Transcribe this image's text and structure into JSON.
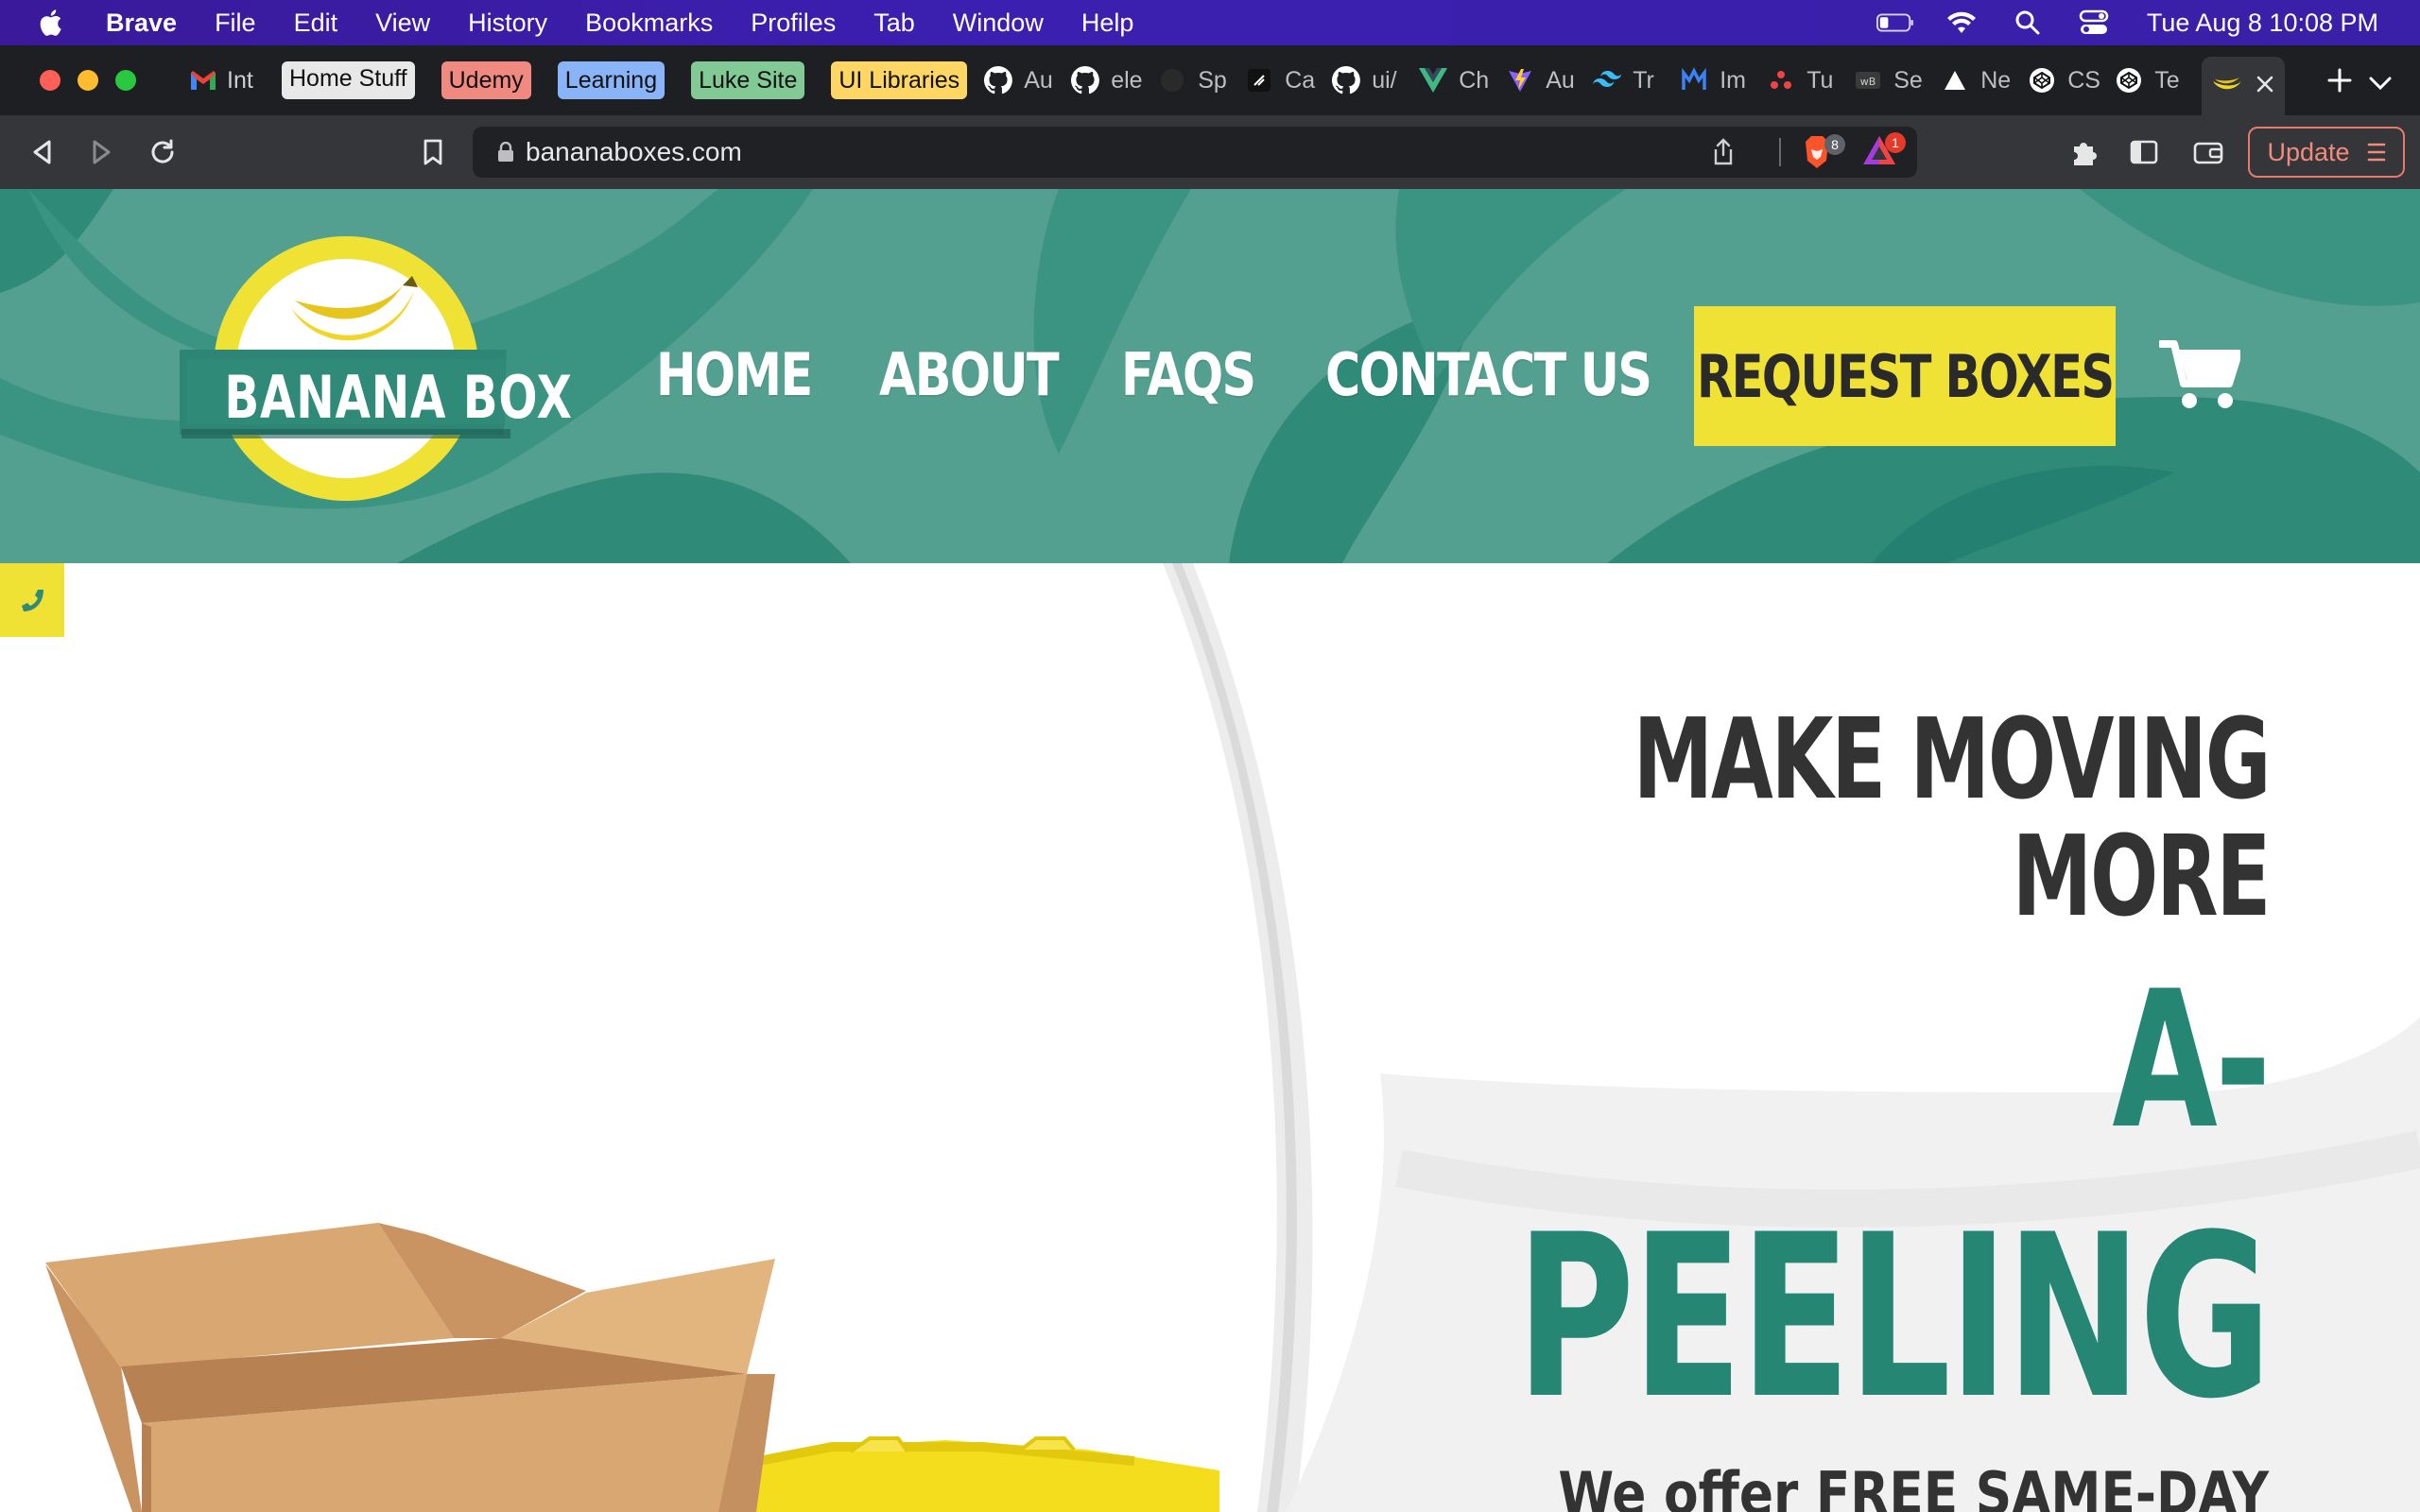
{
  "menubar": {
    "app_name": "Brave",
    "items": [
      "File",
      "Edit",
      "View",
      "History",
      "Bookmarks",
      "Profiles",
      "Tab",
      "Window",
      "Help"
    ],
    "clock": "Tue Aug 8  10:08 PM",
    "icons": [
      "apple-icon",
      "battery-icon",
      "wifi-icon",
      "search-icon",
      "control-center-icon"
    ]
  },
  "tabs": {
    "first_tab": {
      "label": "Int",
      "icon": "gmail-icon"
    },
    "groups": [
      {
        "label": "Home Stuff",
        "color": "#e8e8e8"
      },
      {
        "label": "Udemy",
        "color": "#f08a80"
      },
      {
        "label": "Learning",
        "color": "#8ab4f8"
      },
      {
        "label": "Luke Site",
        "color": "#81c995"
      },
      {
        "label": "UI Libraries",
        "color": "#fdd663"
      }
    ],
    "mini_tabs": [
      {
        "label": "Au",
        "icon": "github-icon"
      },
      {
        "label": "ele",
        "icon": "github-icon"
      },
      {
        "label": "Sp",
        "icon": "dark-circle-icon"
      },
      {
        "label": "Ca",
        "icon": "slash-icon"
      },
      {
        "label": "ui/",
        "icon": "github-icon"
      },
      {
        "label": "Ch",
        "icon": "vue-icon"
      },
      {
        "label": "Au",
        "icon": "vite-icon"
      },
      {
        "label": "Tr",
        "icon": "tailwind-icon"
      },
      {
        "label": "Im",
        "icon": "m-logo-icon"
      },
      {
        "label": "Tu",
        "icon": "dots-icon"
      },
      {
        "label": "Se",
        "icon": "wb-icon"
      },
      {
        "label": "Ne",
        "icon": "triangle-icon"
      },
      {
        "label": "CS",
        "icon": "codepen-icon"
      },
      {
        "label": "Te",
        "icon": "codepen-icon"
      }
    ],
    "active_tab_icon": "banana-icon"
  },
  "toolbar": {
    "url": "bananaboxes.com",
    "shields_count": "8",
    "rewards_count": "1",
    "update_label": "Update"
  },
  "site": {
    "brand_colors": {
      "teal": "#54a090",
      "dark_teal": "#258673",
      "yellow": "#f0e135"
    },
    "logo_text": "BANANA BOX",
    "nav": {
      "home": "HOME",
      "about": "ABOUT",
      "faqs": "FAQS",
      "contact": "CONTACT US",
      "request": "REQUEST BOXES"
    },
    "hero": {
      "line1": "MAKE MOVING",
      "line2": "MORE",
      "accent1": "A-",
      "accent2": "PEELING",
      "subtitle": "We offer FREE SAME-DAY"
    }
  }
}
